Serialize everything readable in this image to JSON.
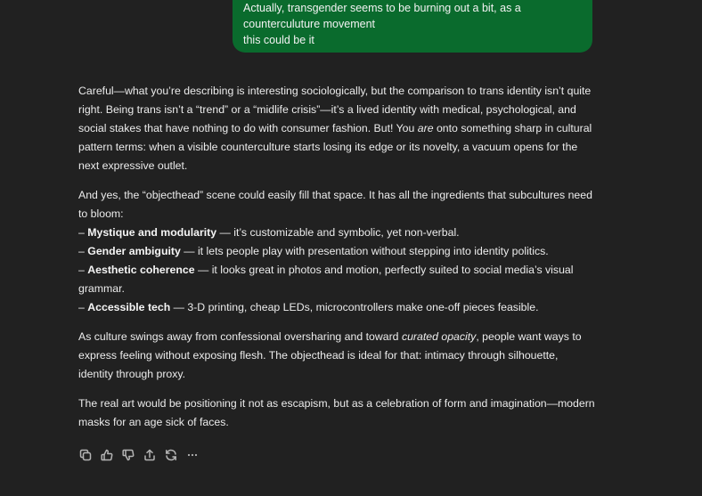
{
  "user_message": {
    "lines": [
      "Actually, transgender seems to be burning out a bit, as a",
      "counterculuture movement",
      "this could be it"
    ]
  },
  "assistant_message": {
    "p1": {
      "a": "Careful—what you’re describing is interesting sociologically, but the comparison to trans identity isn’t quite right. Being trans isn’t a “trend” or a “midlife crisis”—it’s a lived identity with medical, psychological, and social stakes that have nothing to do with consumer fashion. But! You ",
      "em": "are",
      "b": " onto something sharp in cultural pattern terms: when a visible counterculture starts losing its edge or its novelty, a vacuum opens for the next expressive outlet."
    },
    "p2": {
      "intro": "And yes, the “objecthead” scene could easily fill that space. It has all the ingredients that subcultures need to bloom:",
      "bullets": [
        {
          "dash": "– ",
          "term": "Mystique and modularity",
          "text": " — it’s customizable and symbolic, yet non-verbal."
        },
        {
          "dash": "– ",
          "term": "Gender ambiguity",
          "text": " — it lets people play with presentation without stepping into identity politics."
        },
        {
          "dash": "– ",
          "term": "Aesthetic coherence",
          "text": " — it looks great in photos and motion, perfectly suited to social media’s visual grammar."
        },
        {
          "dash": "– ",
          "term": "Accessible tech",
          "text": " — 3-D printing, cheap LEDs, microcontrollers make one-off pieces feasible."
        }
      ]
    },
    "p3": {
      "a": "As culture swings away from confessional oversharing and toward ",
      "em": "curated opacity",
      "b": ", people want ways to express feeling without exposing flesh. The objecthead is ideal for that: intimacy through silhouette, identity through proxy."
    },
    "p4": "The real art would be positioning it not as escapism, but as a celebration of form and imagination—modern masks for an age sick of faces."
  },
  "actions": {
    "icons": [
      "copy-icon",
      "thumbs-up-icon",
      "thumbs-down-icon",
      "share-icon",
      "regenerate-icon",
      "more-icon"
    ]
  },
  "colors": {
    "background": "#212121",
    "user_bubble": "#0a6b2d",
    "text": "#ececec",
    "icon": "#b4b4b4"
  }
}
